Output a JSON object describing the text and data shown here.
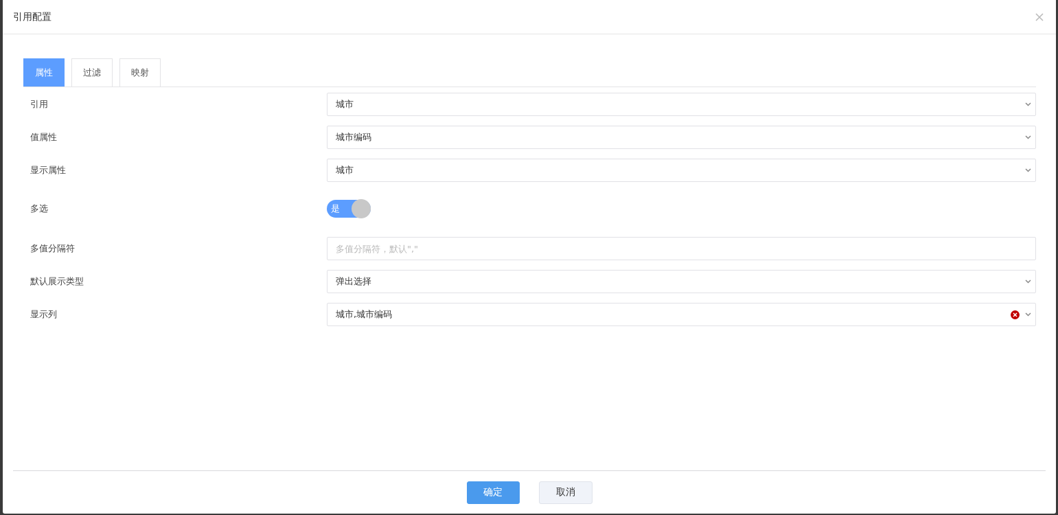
{
  "dialog": {
    "title": "引用配置"
  },
  "tabs": [
    {
      "label": "属性",
      "selected": true
    },
    {
      "label": "过滤",
      "selected": false
    },
    {
      "label": "映射",
      "selected": false
    }
  ],
  "fields": [
    {
      "kind": "select",
      "label": "引用",
      "value": "城市",
      "clearable": false
    },
    {
      "kind": "select",
      "label": "值属性",
      "value": "城市编码",
      "clearable": false
    },
    {
      "kind": "select",
      "label": "显示属性",
      "value": "城市",
      "clearable": false
    },
    {
      "kind": "switch",
      "label": "多选",
      "on": true,
      "text": "是"
    },
    {
      "kind": "input",
      "label": "多值分隔符",
      "placeholder": "多值分隔符，默认\",\""
    },
    {
      "kind": "select",
      "label": "默认展示类型",
      "value": "弹出选择",
      "clearable": false
    },
    {
      "kind": "select",
      "label": "显示列",
      "value": "城市,城市编码",
      "clearable": true
    }
  ],
  "buttons": [
    {
      "kind": "primary",
      "label": "确定"
    },
    {
      "kind": "default",
      "label": "取消"
    }
  ]
}
